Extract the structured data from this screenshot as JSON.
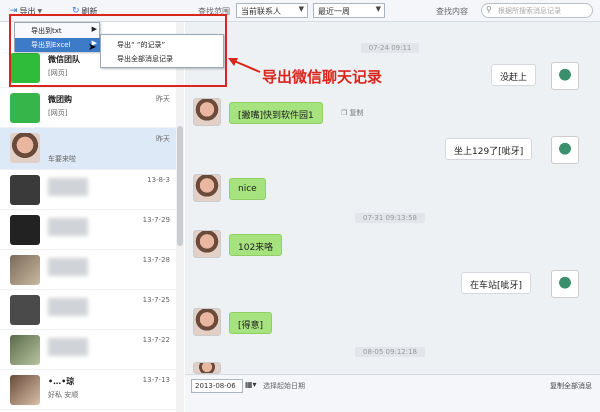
{
  "toolbar": {
    "export_label": "导出",
    "refresh_label": "刷新",
    "range_label": "查找范围",
    "contact_combo": "当前联系人",
    "period_combo": "最近一周",
    "content_label": "查找内容",
    "search_placeholder": "根据所搜索消息记录"
  },
  "export_menu": {
    "items": [
      {
        "label": "导出到txt"
      },
      {
        "label": "导出到Excel"
      }
    ]
  },
  "export_submenu": {
    "items": [
      {
        "label": "导出“ ”的记录”"
      },
      {
        "label": "导出全部消息记录"
      }
    ]
  },
  "annotation": "导出微信聊天记录",
  "contacts": [
    {
      "name": "微信团队",
      "sub": "[网页]",
      "date": ""
    },
    {
      "name": "微团购",
      "sub": "[网页]",
      "date": "昨天"
    },
    {
      "name": "",
      "sub": "车要来啦",
      "date": "昨天"
    },
    {
      "name": "",
      "sub": "",
      "date": "13-8-3"
    },
    {
      "name": "",
      "sub": "",
      "date": "13-7-29"
    },
    {
      "name": "",
      "sub": "",
      "date": "13-7-28"
    },
    {
      "name": "",
      "sub": "",
      "date": "13-7-25"
    },
    {
      "name": "",
      "sub": "",
      "date": "13-7-22"
    },
    {
      "name": "•…•琼",
      "sub": "好私 安顺",
      "date": "13-7-13"
    }
  ],
  "chat": {
    "times": [
      "07-24 09:11",
      "07-31 09:13:58",
      "08-05 09:12:18"
    ],
    "messages": [
      {
        "text": "没赶上",
        "side": "right"
      },
      {
        "text": "[撇嘴]快到软件园1",
        "side": "left"
      },
      {
        "text": "坐上129了[呲牙]",
        "side": "right"
      },
      {
        "text": "nice",
        "side": "left"
      },
      {
        "text": "102来咯",
        "side": "left"
      },
      {
        "text": "在车站[呲牙]",
        "side": "right"
      },
      {
        "text": "[得意]",
        "side": "left"
      }
    ],
    "copy_label": "复制"
  },
  "statusbar": {
    "date_value": "2013-08-06",
    "date_hint": "选择起始日期",
    "copy_all": "复制全部消息"
  },
  "colors": {
    "accent_red": "#d9251c",
    "bubble_green": "#a6e27e",
    "menu_highlight": "#3d7bc9"
  }
}
